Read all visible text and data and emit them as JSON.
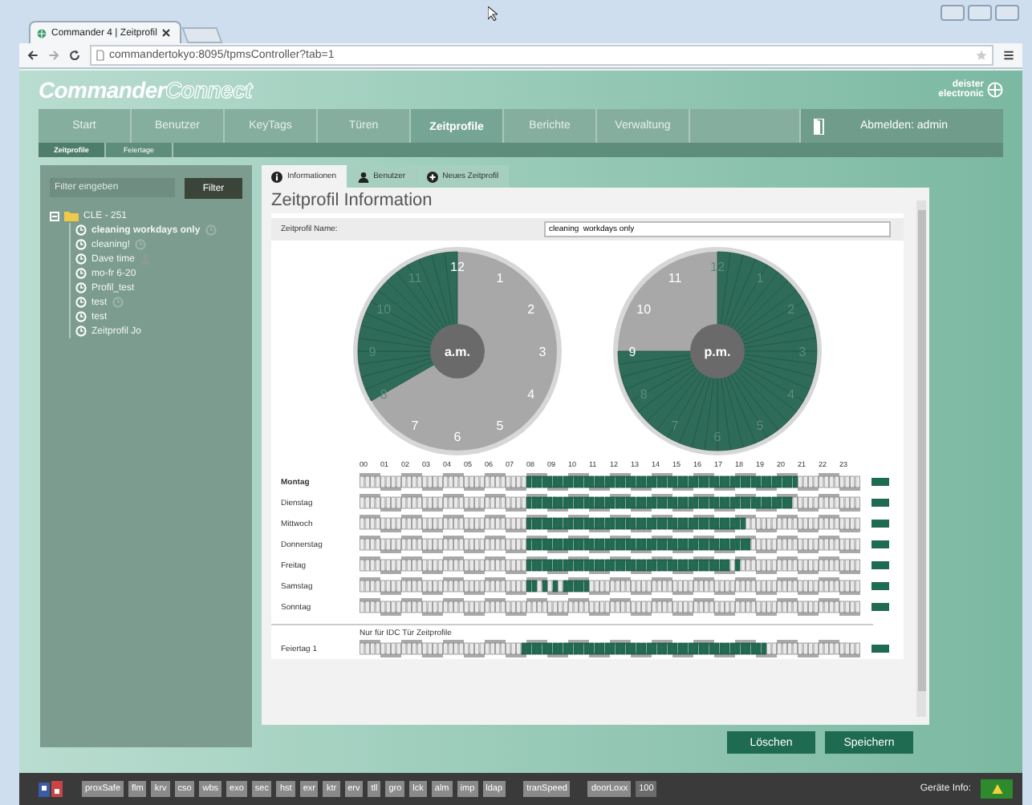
{
  "browser": {
    "tab_title": "Commander 4 | Zeitprofil",
    "url": "commandertokyo:8095/tpmsController?tab=1"
  },
  "header": {
    "logo_primary": "Commander",
    "logo_secondary": "Connect",
    "brand": [
      "deister",
      "electronic"
    ]
  },
  "nav": [
    {
      "label": "Start",
      "selected": false
    },
    {
      "label": "Benutzer",
      "selected": false
    },
    {
      "label": "KeyTags",
      "selected": false
    },
    {
      "label": "Türen",
      "selected": false
    },
    {
      "label": "Zeitprofile",
      "selected": true
    },
    {
      "label": "Berichte",
      "selected": false
    },
    {
      "label": "Verwaltung",
      "selected": false
    }
  ],
  "logout": "Abmelden: admin",
  "subnav": [
    {
      "label": "Zeitprofile",
      "selected": true
    },
    {
      "label": "Feiertage",
      "selected": false
    }
  ],
  "sidebar": {
    "filter_placeholder": "Filter eingeben",
    "filter_button": "Filter",
    "tree": [
      {
        "label": "CLE - 251",
        "expanded": true,
        "children": [
          {
            "label": "cleaning workdays only",
            "selected": true,
            "kind": "clock"
          },
          {
            "label": "cleaning!",
            "selected": false,
            "kind": "clock"
          },
          {
            "label": "Dave time",
            "selected": false,
            "kind": "person"
          },
          {
            "label": "mo-fr 6-20",
            "selected": false,
            "kind": "plain"
          },
          {
            "label": "Profil_test",
            "selected": false,
            "kind": "plain"
          },
          {
            "label": "test",
            "selected": false,
            "kind": "clock"
          },
          {
            "label": "test",
            "selected": false,
            "kind": "plain"
          },
          {
            "label": "Zeitprofil Jo",
            "selected": false,
            "kind": "plain"
          }
        ]
      }
    ]
  },
  "tabs": [
    {
      "label": "Informationen",
      "kind": "info",
      "selected": true
    },
    {
      "label": "Benutzer",
      "kind": "user",
      "selected": false
    },
    {
      "label": "Neues Zeitprofil",
      "kind": "add",
      "selected": false
    }
  ],
  "title": "Zeitprofil Information",
  "name_field": {
    "label": "Zeitprofil Name:",
    "value": "cleaning  workdays only"
  },
  "clocks": [
    {
      "label": "a.m.",
      "kind": "am",
      "numbers": [
        "12",
        "1",
        "2",
        "3",
        "4",
        "5",
        "6",
        "7",
        "8",
        "9",
        "10",
        "11"
      ]
    },
    {
      "label": "p.m.",
      "kind": "pm",
      "numbers": [
        "12",
        "1",
        "2",
        "3",
        "4",
        "5",
        "6",
        "7",
        "8",
        "9",
        "10",
        "11"
      ]
    }
  ],
  "hours": [
    "00",
    "01",
    "02",
    "03",
    "04",
    "05",
    "06",
    "07",
    "08",
    "09",
    "10",
    "11",
    "12",
    "13",
    "14",
    "15",
    "16",
    "17",
    "18",
    "19",
    "20",
    "21",
    "22",
    "23"
  ],
  "days": [
    {
      "label": "Montag",
      "selected": true,
      "slots": [
        false,
        false,
        false,
        false,
        false,
        false,
        false,
        false,
        false,
        false,
        false,
        false,
        false,
        false,
        false,
        false,
        false,
        false,
        false,
        false,
        false,
        false,
        false,
        false,
        false,
        false,
        false,
        false,
        false,
        false,
        false,
        false,
        true,
        true,
        true,
        true,
        true,
        true,
        true,
        true,
        true,
        true,
        true,
        true,
        true,
        true,
        true,
        true,
        true,
        true,
        true,
        true,
        true,
        true,
        true,
        true,
        true,
        true,
        true,
        true,
        true,
        true,
        true,
        true,
        true,
        true,
        true,
        true,
        true,
        true,
        true,
        true,
        true,
        true,
        true,
        true,
        true,
        true,
        true,
        true,
        true,
        true,
        true,
        true,
        false,
        false,
        false,
        false,
        false,
        false,
        false,
        false,
        false,
        false,
        false,
        false
      ]
    },
    {
      "label": "Dienstag",
      "selected": false,
      "slots": [
        false,
        false,
        false,
        false,
        false,
        false,
        false,
        false,
        false,
        false,
        false,
        false,
        false,
        false,
        false,
        false,
        false,
        false,
        false,
        false,
        false,
        false,
        false,
        false,
        false,
        false,
        false,
        false,
        false,
        false,
        false,
        false,
        true,
        true,
        true,
        true,
        true,
        true,
        true,
        true,
        true,
        true,
        true,
        true,
        true,
        true,
        true,
        true,
        true,
        true,
        true,
        true,
        true,
        true,
        true,
        true,
        true,
        true,
        true,
        true,
        true,
        true,
        true,
        true,
        true,
        true,
        true,
        true,
        true,
        true,
        true,
        true,
        true,
        true,
        true,
        true,
        true,
        true,
        true,
        true,
        true,
        true,
        true,
        false,
        false,
        false,
        false,
        false,
        false,
        false,
        false,
        false,
        false,
        false,
        false,
        false
      ]
    },
    {
      "label": "Mittwoch",
      "selected": false,
      "slots": [
        false,
        false,
        false,
        false,
        false,
        false,
        false,
        false,
        false,
        false,
        false,
        false,
        false,
        false,
        false,
        false,
        false,
        false,
        false,
        false,
        false,
        false,
        false,
        false,
        false,
        false,
        false,
        false,
        false,
        false,
        false,
        false,
        true,
        true,
        true,
        true,
        true,
        true,
        true,
        true,
        true,
        true,
        true,
        true,
        true,
        true,
        true,
        true,
        true,
        true,
        true,
        true,
        true,
        true,
        true,
        true,
        true,
        true,
        true,
        true,
        true,
        true,
        true,
        true,
        true,
        true,
        true,
        true,
        true,
        true,
        true,
        true,
        true,
        true,
        false,
        false,
        false,
        false,
        false,
        false,
        false,
        false,
        false,
        false,
        false,
        false,
        false,
        false,
        false,
        false,
        false,
        false,
        false,
        false,
        false,
        false
      ]
    },
    {
      "label": "Donnerstag",
      "selected": false,
      "slots": [
        false,
        false,
        false,
        false,
        false,
        false,
        false,
        false,
        false,
        false,
        false,
        false,
        false,
        false,
        false,
        false,
        false,
        false,
        false,
        false,
        false,
        false,
        false,
        false,
        false,
        false,
        false,
        false,
        false,
        false,
        false,
        false,
        true,
        true,
        true,
        true,
        true,
        true,
        true,
        true,
        true,
        true,
        true,
        true,
        true,
        true,
        true,
        true,
        true,
        true,
        true,
        true,
        true,
        true,
        true,
        true,
        true,
        true,
        true,
        true,
        true,
        true,
        true,
        true,
        true,
        true,
        true,
        true,
        true,
        true,
        true,
        true,
        true,
        true,
        true,
        false,
        false,
        false,
        false,
        false,
        false,
        false,
        false,
        false,
        false,
        false,
        false,
        false,
        false,
        false,
        false,
        false,
        false,
        false,
        false,
        false
      ]
    },
    {
      "label": "Freitag",
      "selected": false,
      "slots": [
        false,
        false,
        false,
        false,
        false,
        false,
        false,
        false,
        false,
        false,
        false,
        false,
        false,
        false,
        false,
        false,
        false,
        false,
        false,
        false,
        false,
        false,
        false,
        false,
        false,
        false,
        false,
        false,
        false,
        false,
        false,
        false,
        true,
        true,
        true,
        true,
        true,
        true,
        true,
        true,
        true,
        true,
        true,
        true,
        true,
        true,
        true,
        true,
        true,
        true,
        true,
        true,
        true,
        true,
        true,
        true,
        true,
        true,
        true,
        true,
        true,
        true,
        true,
        true,
        true,
        true,
        true,
        true,
        true,
        true,
        true,
        false,
        true,
        false,
        false,
        false,
        false,
        false,
        false,
        false,
        false,
        false,
        false,
        false,
        false,
        false,
        false,
        false,
        false,
        false,
        false,
        false,
        false,
        false,
        false,
        false
      ]
    },
    {
      "label": "Samstag",
      "selected": false,
      "slots": [
        false,
        false,
        false,
        false,
        false,
        false,
        false,
        false,
        false,
        false,
        false,
        false,
        false,
        false,
        false,
        false,
        false,
        false,
        false,
        false,
        false,
        false,
        false,
        false,
        false,
        false,
        false,
        false,
        false,
        false,
        false,
        false,
        true,
        true,
        false,
        true,
        false,
        true,
        false,
        true,
        true,
        true,
        true,
        true,
        false,
        false,
        false,
        false,
        false,
        false,
        false,
        false,
        false,
        false,
        false,
        false,
        false,
        false,
        false,
        false,
        false,
        false,
        false,
        false,
        false,
        false,
        false,
        false,
        false,
        false,
        false,
        false,
        false,
        false,
        false,
        false,
        false,
        false,
        false,
        false,
        false,
        false,
        false,
        false,
        false,
        false,
        false,
        false,
        false,
        false,
        false,
        false,
        false,
        false,
        false,
        false
      ]
    },
    {
      "label": "Sonntag",
      "selected": false,
      "slots": [
        false,
        false,
        false,
        false,
        false,
        false,
        false,
        false,
        false,
        false,
        false,
        false,
        false,
        false,
        false,
        false,
        false,
        false,
        false,
        false,
        false,
        false,
        false,
        false,
        false,
        false,
        false,
        false,
        false,
        false,
        false,
        false,
        false,
        false,
        false,
        false,
        false,
        false,
        false,
        false,
        false,
        false,
        false,
        false,
        false,
        false,
        false,
        false,
        false,
        false,
        false,
        false,
        false,
        false,
        false,
        false,
        false,
        false,
        false,
        false,
        false,
        false,
        false,
        false,
        false,
        false,
        false,
        false,
        false,
        false,
        false,
        false,
        false,
        false,
        false,
        false,
        false,
        false,
        false,
        false,
        false,
        false,
        false,
        false,
        false,
        false,
        false,
        false,
        false,
        false,
        false,
        false,
        false,
        false,
        false,
        false
      ]
    }
  ],
  "holiday_note": "Nur für IDC Tür Zeitprofile",
  "holidays": [
    {
      "label": "Feiertag 1",
      "selected": false,
      "slots": [
        false,
        false,
        false,
        false,
        false,
        false,
        false,
        false,
        false,
        false,
        false,
        false,
        false,
        false,
        false,
        false,
        false,
        false,
        false,
        false,
        false,
        false,
        false,
        false,
        false,
        false,
        false,
        false,
        false,
        false,
        false,
        true,
        true,
        true,
        true,
        true,
        true,
        true,
        true,
        true,
        true,
        true,
        true,
        true,
        true,
        true,
        true,
        true,
        true,
        true,
        true,
        true,
        true,
        true,
        true,
        true,
        true,
        true,
        true,
        true,
        true,
        true,
        true,
        true,
        true,
        true,
        true,
        true,
        true,
        true,
        true,
        true,
        true,
        true,
        true,
        true,
        true,
        true,
        false,
        false,
        false,
        false,
        false,
        false,
        false,
        false,
        false,
        false,
        false,
        false,
        false,
        false,
        false,
        false,
        false,
        false
      ]
    }
  ],
  "buttons": [
    "Löschen",
    "Speichern"
  ],
  "footer": {
    "modules": [
      [
        "proxSafe",
        "flm",
        "krv",
        "cso",
        "wbs",
        "exo",
        "sec",
        "hst",
        "exr",
        "ktr",
        "erv",
        "tll",
        "gro",
        "lck",
        "alm",
        "imp",
        "ldap"
      ],
      [
        "tranSpeed"
      ],
      [
        "doorLoxx",
        "100"
      ]
    ],
    "device_info": "Geräte Info:"
  }
}
